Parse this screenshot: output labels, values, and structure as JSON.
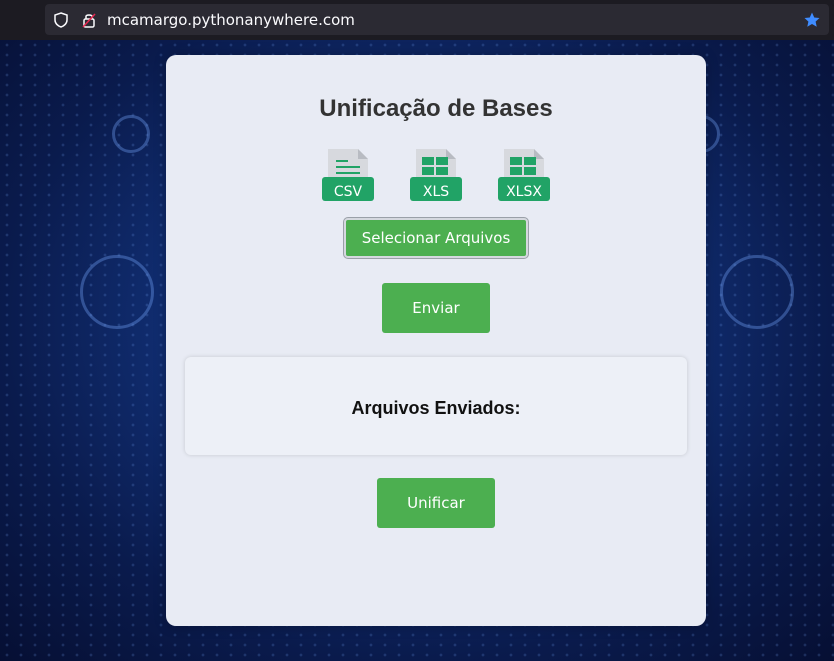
{
  "browser": {
    "url": "mcamargo.pythonanywhere.com"
  },
  "page": {
    "title": "Unificação de Bases",
    "file_types": [
      {
        "label": "CSV",
        "icon": "csv-file-icon"
      },
      {
        "label": "XLS",
        "icon": "xls-file-icon"
      },
      {
        "label": "XLSX",
        "icon": "xlsx-file-icon"
      }
    ],
    "select_button_label": "Selecionar Arquivos",
    "send_button_label": "Enviar",
    "uploaded_title": "Arquivos Enviados:",
    "unify_button_label": "Unificar"
  },
  "colors": {
    "accent_green": "#4caf50",
    "card_bg": "#e8ebf4",
    "file_icon_green": "#21a366"
  }
}
